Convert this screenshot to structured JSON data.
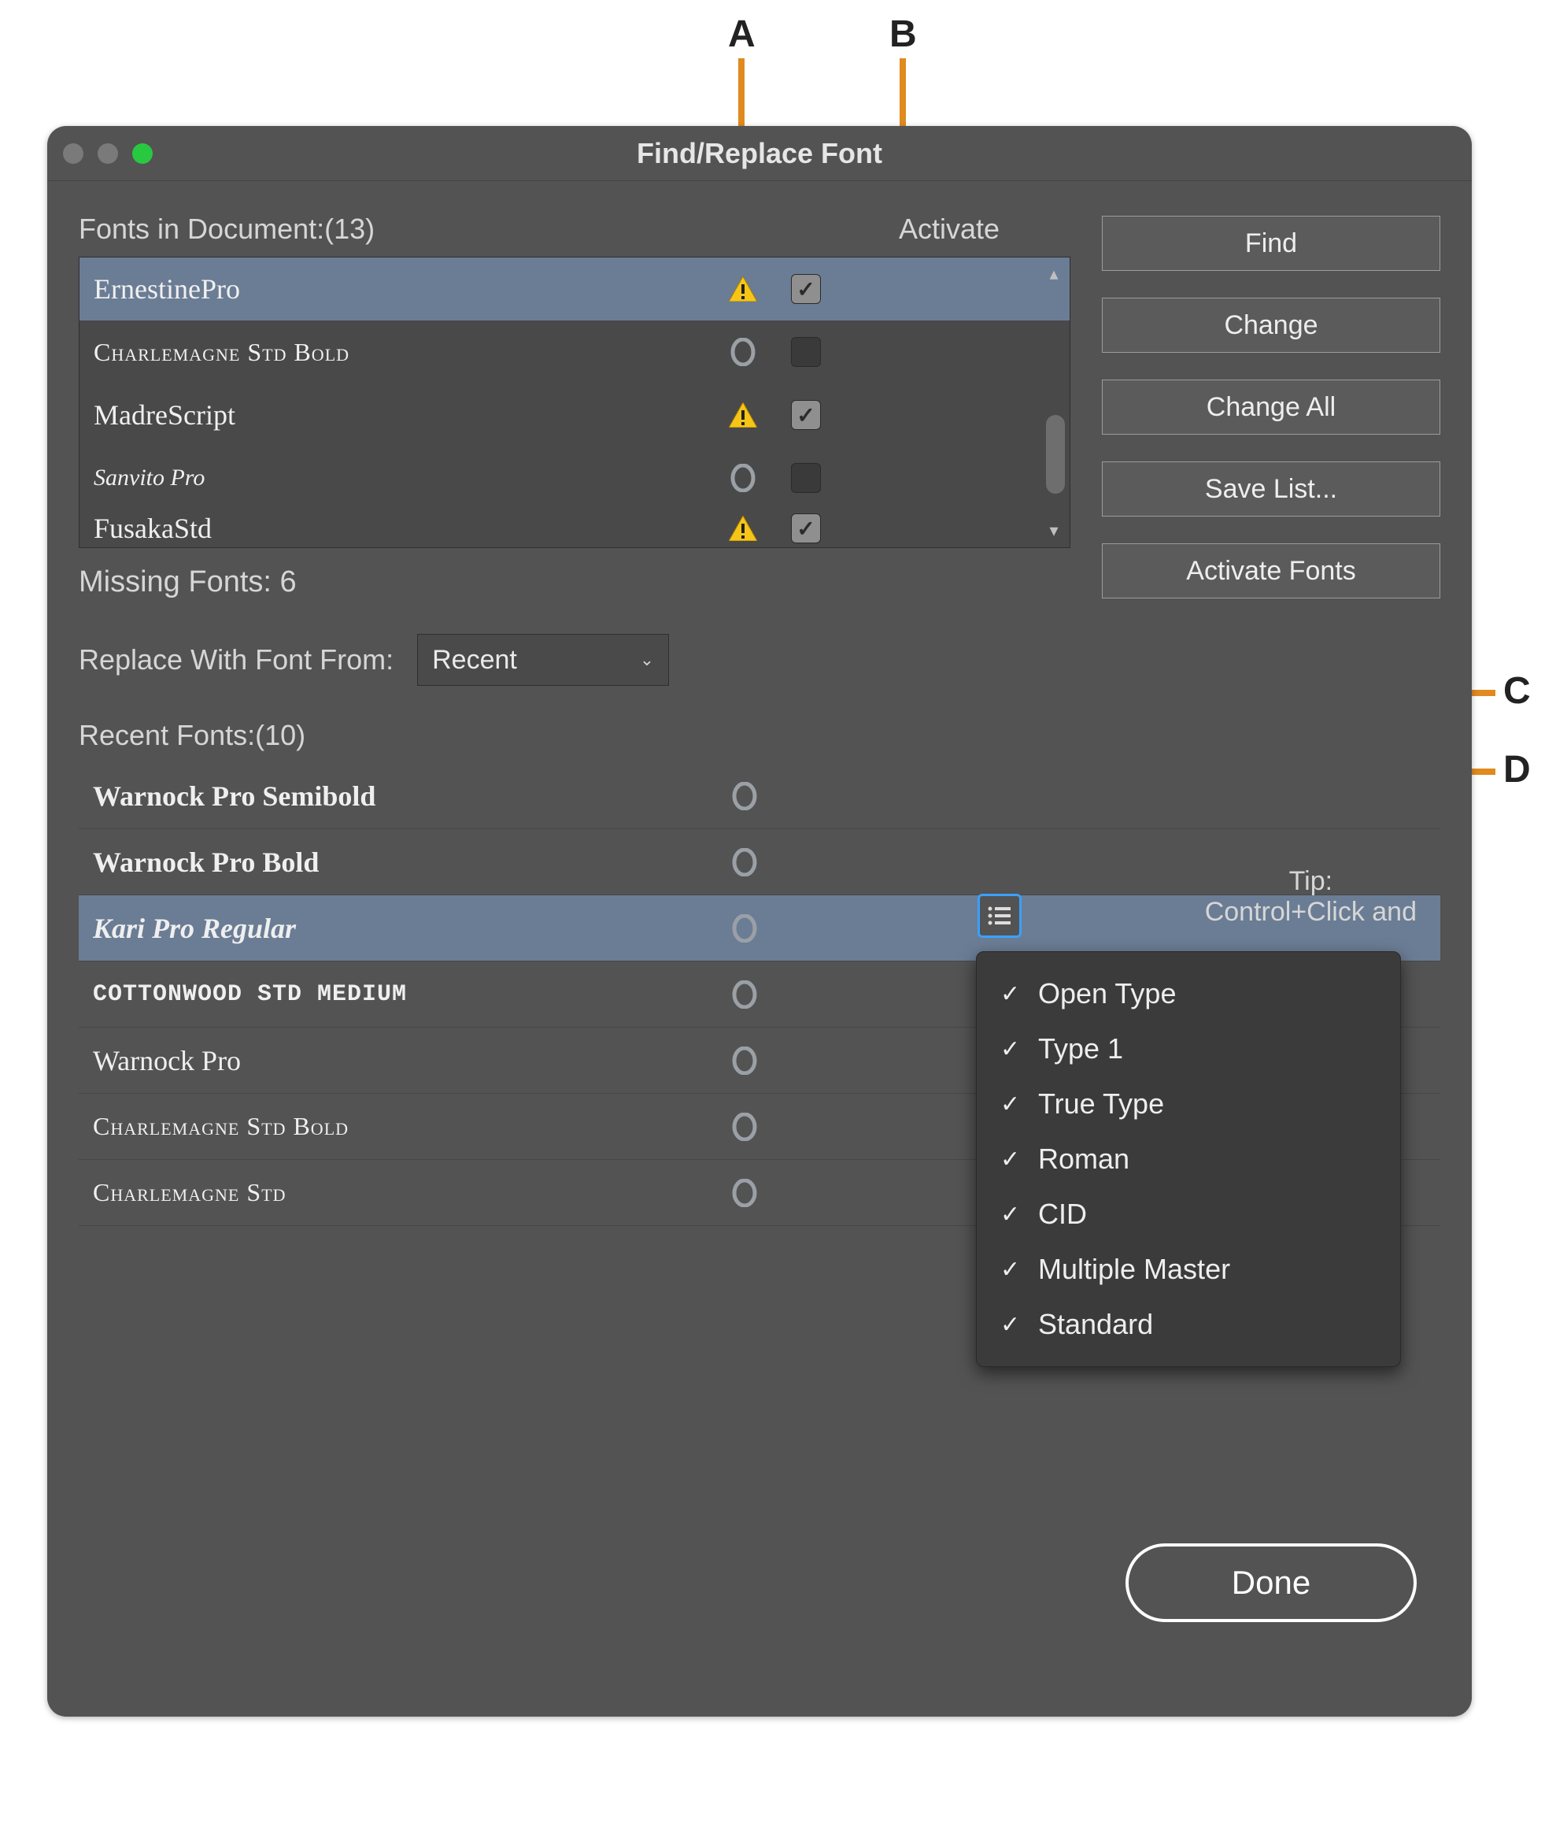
{
  "dialog": {
    "title": "Find/Replace Font"
  },
  "header": {
    "fonts_in_doc_label": "Fonts in Document:(13)",
    "activate_label": "Activate"
  },
  "font_rows": [
    {
      "name": "ErnestinePro",
      "missing": true,
      "activate_checked": true,
      "selected": true,
      "style": "sv1"
    },
    {
      "name": "Charlemagne Std Bold",
      "missing": false,
      "activate_checked": false,
      "selected": false,
      "style": "sv2"
    },
    {
      "name": "MadreScript",
      "missing": true,
      "activate_checked": true,
      "selected": false,
      "style": "sv1"
    },
    {
      "name": "Sanvito Pro",
      "missing": false,
      "activate_checked": false,
      "selected": false,
      "style": "sv4"
    },
    {
      "name": "FusakaStd",
      "missing": true,
      "activate_checked": true,
      "selected": false,
      "style": "sv1"
    }
  ],
  "missing_label": "Missing Fonts: 6",
  "replace": {
    "label": "Replace With Font From:",
    "value": "Recent"
  },
  "recent": {
    "label": "Recent Fonts:(10)",
    "rows": [
      {
        "name": "Warnock Pro Semibold",
        "style": "fn-a",
        "selected": false
      },
      {
        "name": "Warnock Pro Bold",
        "style": "fn-b",
        "selected": false
      },
      {
        "name": "Kari Pro Regular",
        "style": "fn-c",
        "selected": true
      },
      {
        "name": "COTTONWOOD STD MEDIUM",
        "style": "fn-d",
        "selected": false
      },
      {
        "name": "Warnock Pro",
        "style": "fn-e",
        "selected": false
      },
      {
        "name": "Charlemagne Std Bold",
        "style": "fn-f",
        "selected": false
      },
      {
        "name": "Charlemagne Std",
        "style": "fn-f",
        "selected": false
      }
    ]
  },
  "buttons": {
    "find": "Find",
    "change": "Change",
    "change_all": "Change All",
    "save_list": "Save List...",
    "activate_fonts": "Activate Fonts",
    "done": "Done"
  },
  "tip": {
    "label": "Tip:",
    "line2": "Control+Click and"
  },
  "filter_menu": [
    "Open Type",
    "Type 1",
    "True Type",
    "Roman",
    "CID",
    "Multiple Master",
    "Standard"
  ],
  "callouts": {
    "A": "A",
    "B": "B",
    "C": "C",
    "D": "D"
  },
  "colors": {
    "accent_callout": "#e08a1f",
    "selection": "#6b7d95",
    "filter_focus": "#3aa0ff"
  }
}
